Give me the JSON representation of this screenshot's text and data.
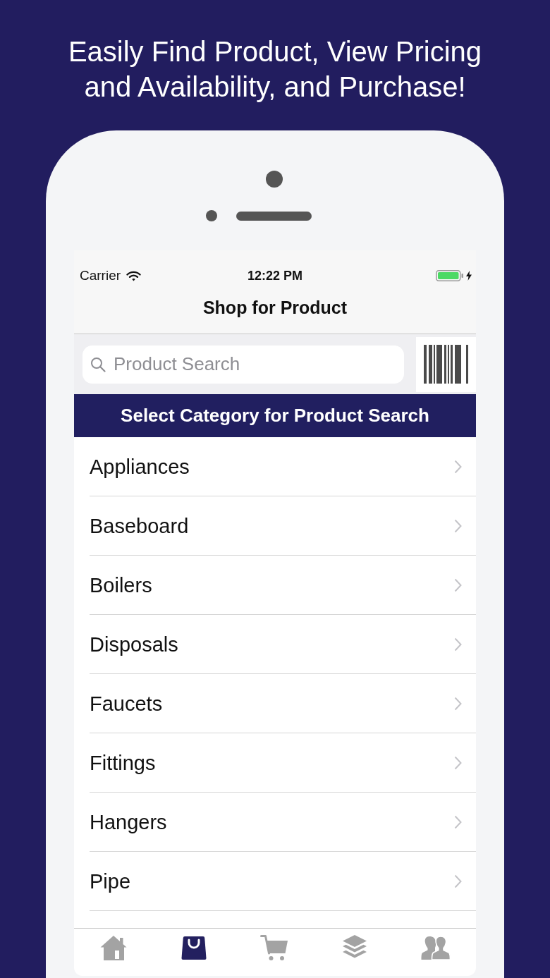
{
  "headline": "Easily Find Product, View Pricing and Availability, and Purchase!",
  "status_bar": {
    "carrier": "Carrier",
    "time": "12:22 PM"
  },
  "nav_bar": {
    "title": "Shop for Product"
  },
  "search": {
    "placeholder": "Product Search"
  },
  "category_header": "Select Category for Product Search",
  "categories": [
    "Appliances",
    "Baseboard",
    "Boilers",
    "Disposals",
    "Faucets",
    "Fittings",
    "Hangers",
    "Pipe"
  ],
  "tab_bar": [
    {
      "kind": "home",
      "selected": false
    },
    {
      "kind": "shop",
      "selected": true
    },
    {
      "kind": "cart",
      "selected": false
    },
    {
      "kind": "layers",
      "selected": false
    },
    {
      "kind": "people",
      "selected": false
    }
  ]
}
